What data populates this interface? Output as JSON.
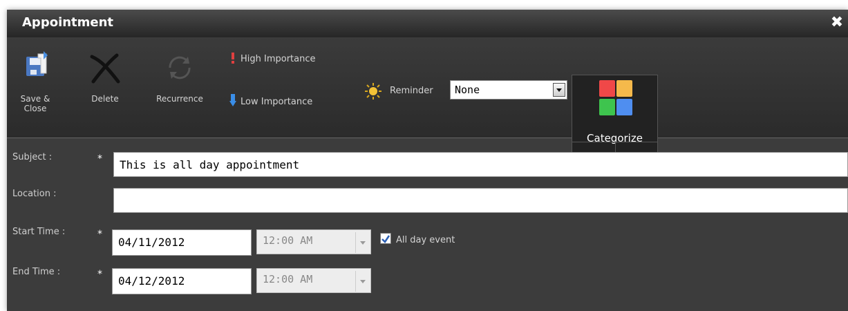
{
  "window": {
    "title": "Appointment"
  },
  "toolbar": {
    "save_close_line1": "Save &",
    "save_close_line2": "Close",
    "delete_label": "Delete",
    "recurrence_label": "Recurrence",
    "high_importance_label": "High Importance",
    "low_importance_label": "Low Importance",
    "reminder_label": "Reminder",
    "reminder_value": "None",
    "categorize_label": "Categorize",
    "categorize_colors": [
      "#f04848",
      "#f5b94b",
      "#3ec44e",
      "#4f8ef0"
    ]
  },
  "form": {
    "subject": {
      "label": "Subject :",
      "required": "*",
      "value": "This is all day appointment"
    },
    "location": {
      "label": "Location :",
      "value": ""
    },
    "start_time": {
      "label": "Start Time :",
      "required": "*",
      "date": "04/11/2012",
      "time": "12:00 AM"
    },
    "end_time": {
      "label": "End Time :",
      "required": "*",
      "date": "04/12/2012",
      "time": "12:00 AM"
    },
    "all_day": {
      "label": "All day event",
      "checked": true
    }
  }
}
